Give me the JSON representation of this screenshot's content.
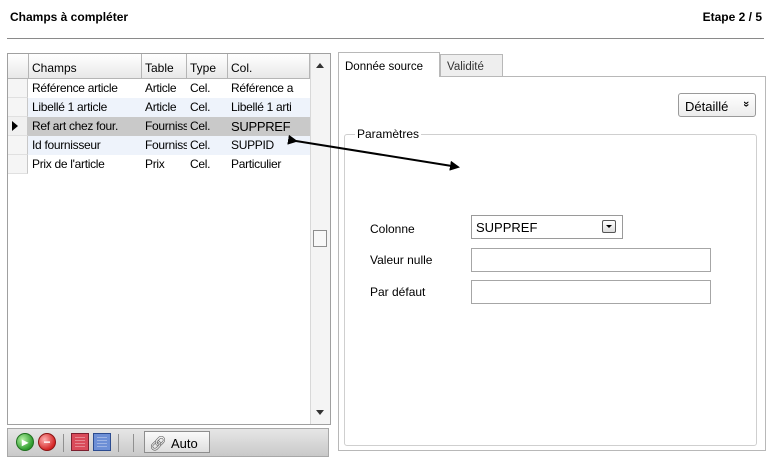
{
  "header": {
    "title": "Champs à compléter",
    "step": "Etape  2 / 5"
  },
  "grid": {
    "columns": [
      "Champs",
      "Table",
      "Type",
      "Col."
    ],
    "rows": [
      {
        "champs": "Référence article",
        "table": "Article",
        "type": "Cel.",
        "col": "Référence a"
      },
      {
        "champs": "Libellé 1 article",
        "table": "Article",
        "type": "Cel.",
        "col": "Libellé 1 arti"
      },
      {
        "champs": "Ref art chez four.",
        "table": "Fourniss",
        "type": "Cel.",
        "col": "SUPPREF"
      },
      {
        "champs": "Id fournisseur",
        "table": "Fourniss",
        "type": "Cel.",
        "col": "SUPPID"
      },
      {
        "champs": "Prix de l'article",
        "table": "Prix",
        "type": "Cel.",
        "col": "Particulier"
      }
    ],
    "selected_row": "Ref art chez four."
  },
  "toolbar": {
    "auto_label": "Auto"
  },
  "tabs": [
    {
      "label": "Donnée source",
      "active": true
    },
    {
      "label": "Validité",
      "active": false
    }
  ],
  "panel": {
    "detail_button": "Détaillé",
    "detail_chevron": "»",
    "group_title": "Paramètres",
    "colonne_label": "Colonne",
    "colonne_value": "SUPPREF",
    "valeur_nulle_label": "Valeur nulle",
    "valeur_nulle_value": "",
    "par_defaut_label": "Par défaut",
    "par_defaut_value": ""
  }
}
